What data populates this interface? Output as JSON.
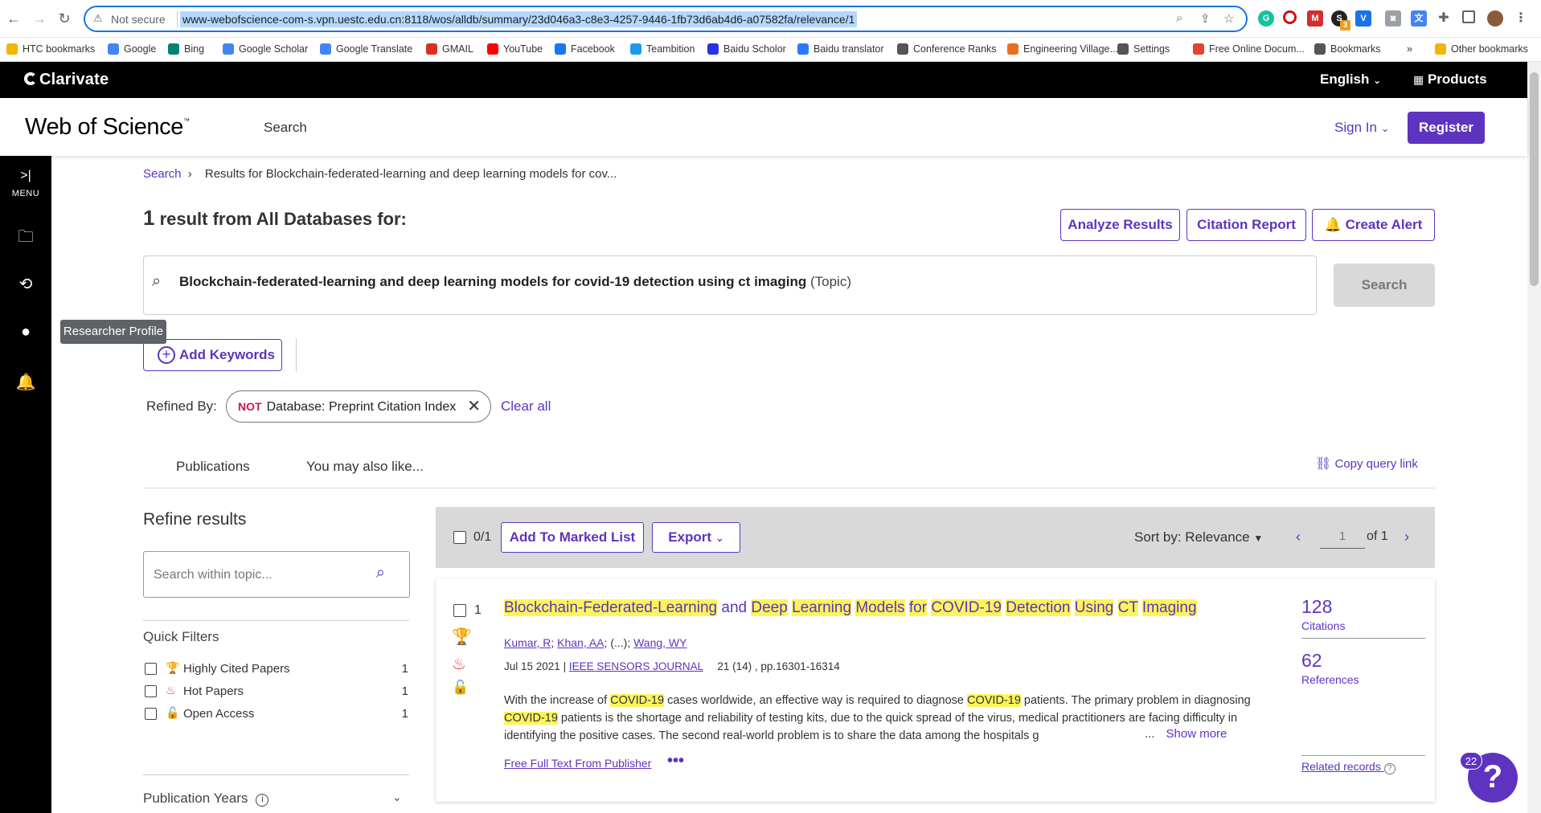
{
  "browser": {
    "security_label": "Not secure",
    "url": "www-webofscience-com-s.vpn.uestc.edu.cn:8118/wos/alldb/summary/23d046a3-c8e3-4257-9446-1fb73d6ab4d6-a07582fa/relevance/1",
    "extension_badge": "3"
  },
  "bookmarks": [
    {
      "label": "HTC bookmarks",
      "icon": "folder-icon",
      "color": "#f2b600"
    },
    {
      "label": "Google",
      "icon": "google-icon",
      "color": "#4285f4"
    },
    {
      "label": "Bing",
      "icon": "bing-icon",
      "color": "#008373"
    },
    {
      "label": "Google Scholar",
      "icon": "scholar-icon",
      "color": "#4285f4"
    },
    {
      "label": "Google Translate",
      "icon": "translate-icon",
      "color": "#4285f4"
    },
    {
      "label": "GMAIL",
      "icon": "gmail-icon",
      "color": "#d93025"
    },
    {
      "label": "YouTube",
      "icon": "youtube-icon",
      "color": "#ff0000"
    },
    {
      "label": "Facebook",
      "icon": "facebook-icon",
      "color": "#1877f2"
    },
    {
      "label": "Teambition",
      "icon": "teambition-icon",
      "color": "#1b9aee"
    },
    {
      "label": "Baidu Scholor",
      "icon": "baidu-icon",
      "color": "#2932e1"
    },
    {
      "label": "Baidu translator",
      "icon": "baidu-translate-icon",
      "color": "#2979ff"
    },
    {
      "label": "Conference Ranks",
      "icon": "globe-icon",
      "color": "#555555"
    },
    {
      "label": "Engineering Village...",
      "icon": "ev-icon",
      "color": "#e9711c"
    },
    {
      "label": "Settings",
      "icon": "gear-icon",
      "color": "#555555"
    },
    {
      "label": "Free Online Docum...",
      "icon": "pdf-icon",
      "color": "#e2442f"
    },
    {
      "label": "Bookmarks",
      "icon": "star-icon",
      "color": "#555555"
    },
    {
      "label": "»",
      "icon": "more-icon",
      "color": "#555555"
    },
    {
      "label": "Other bookmarks",
      "icon": "folder-icon",
      "color": "#f2b600"
    }
  ],
  "clarivate": {
    "logo": "Clarivate",
    "language": "English",
    "products": "Products"
  },
  "header": {
    "logo": "Web of Science",
    "logo_tm": "™",
    "nav_search": "Search",
    "sign_in": "Sign In",
    "register": "Register"
  },
  "sidebar": {
    "menu_label": "MENU",
    "tooltip": "Researcher Profile"
  },
  "breadcrumb": {
    "root": "Search",
    "separator": "›",
    "current": "Results for Blockchain-federated-learning and deep learning models for cov..."
  },
  "results_header": {
    "count": "1",
    "text": " result from All Databases for:",
    "analyze": "Analyze Results",
    "citation_report": "Citation Report",
    "create_alert": "Create Alert"
  },
  "query": {
    "text": "Blockchain-federated-learning and deep learning models for covid-19 detection using ct imaging",
    "field": " (Topic)",
    "search_button": "Search",
    "add_keywords": "Add Keywords"
  },
  "refined": {
    "label": "Refined By:",
    "not": "NOT",
    "filter": "Database: Preprint Citation Index",
    "clear_all": "Clear all"
  },
  "tabs": {
    "publications": "Publications",
    "also_like": "You may also like...",
    "copy_query": "Copy query link"
  },
  "refine": {
    "title": "Refine results",
    "search_placeholder": "Search within topic...",
    "quick_filters_title": "Quick Filters",
    "quick_filters": [
      {
        "label": "Highly Cited Papers",
        "count": "1",
        "icon": "trophy-icon"
      },
      {
        "label": "Hot Papers",
        "count": "1",
        "icon": "flame-icon"
      },
      {
        "label": "Open Access",
        "count": "1",
        "icon": "lock-icon"
      }
    ],
    "pub_years": "Publication Years"
  },
  "toolbar": {
    "selected": "0/1",
    "add_marked": "Add To Marked List",
    "export": "Export",
    "sort": "Sort by: Relevance",
    "page": "1",
    "of": "of 1"
  },
  "record": {
    "number": "1",
    "title_parts": [
      {
        "t": "Blockchain-Federated-Learning",
        "hl": true
      },
      {
        "t": " and ",
        "hl": false
      },
      {
        "t": "Deep",
        "hl": true
      },
      {
        "t": " ",
        "hl": false
      },
      {
        "t": "Learning",
        "hl": true
      },
      {
        "t": " ",
        "hl": false
      },
      {
        "t": "Models",
        "hl": true
      },
      {
        "t": " ",
        "hl": false
      },
      {
        "t": "for",
        "hl": true
      },
      {
        "t": " ",
        "hl": false
      },
      {
        "t": "COVID-19",
        "hl": true
      },
      {
        "t": " ",
        "hl": false
      },
      {
        "t": "Detection",
        "hl": true
      },
      {
        "t": " ",
        "hl": false
      },
      {
        "t": "Using",
        "hl": true
      },
      {
        "t": " ",
        "hl": false
      },
      {
        "t": "CT",
        "hl": true
      },
      {
        "t": " ",
        "hl": false
      },
      {
        "t": "Imaging",
        "hl": true
      }
    ],
    "authors": [
      "Kumar, R",
      "Khan, AA",
      "Wang, WY"
    ],
    "authors_ellipsis": "(...)",
    "date": "Jul 15 2021",
    "journal": "IEEE SENSORS JOURNAL",
    "volume": "21 (14) , pp.16301-16314",
    "abstract_parts": [
      {
        "t": "With the increase of ",
        "hl": false
      },
      {
        "t": "COVID-19",
        "hl": true
      },
      {
        "t": " cases worldwide, an effective way is required to diagnose ",
        "hl": false
      },
      {
        "t": "COVID-19",
        "hl": true
      },
      {
        "t": " patients. The primary problem in diagnosing ",
        "hl": false
      },
      {
        "t": "COVID-19",
        "hl": true
      },
      {
        "t": " patients is the shortage and reliability of testing kits, due to the quick spread of the virus, medical practitioners are facing difficulty in identifying the positive cases. The second real-world problem is to share the data among the hospitals g",
        "hl": false
      }
    ],
    "show_more_ellipsis": "...",
    "show_more": "Show more",
    "free_full_text": "Free Full Text From Publisher",
    "more": "•••",
    "citations": "128",
    "citations_label": "Citations",
    "references": "62",
    "references_label": "References",
    "related": "Related records"
  },
  "help": {
    "badge": "22",
    "icon": "?"
  }
}
